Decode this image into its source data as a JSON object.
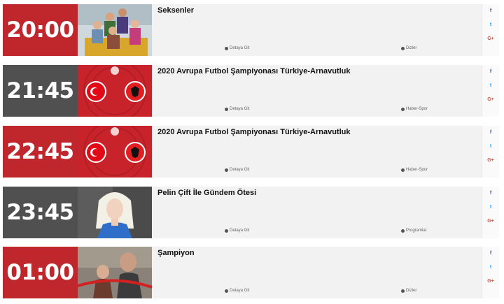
{
  "colors": {
    "red": "#c0272d",
    "dark": "#505050"
  },
  "rows": [
    {
      "time": "20:00",
      "title": "Seksenler",
      "detail_label": "Detaya Git",
      "category": "Dizler",
      "tile": "red",
      "thumb": "family"
    },
    {
      "time": "21:45",
      "title": "2020 Avrupa Futbol Şampiyonası Türkiye-Arnavutluk",
      "detail_label": "Detaya Git",
      "category": "Haber-Spor",
      "tile": "dark",
      "thumb": "flags"
    },
    {
      "time": "22:45",
      "title": "2020 Avrupa Futbol Şampiyonası Türkiye-Arnavutluk",
      "detail_label": "Detaya Git",
      "category": "Haber-Spor",
      "tile": "red",
      "thumb": "flags"
    },
    {
      "time": "23:45",
      "title": "Pelin Çift İle Gündem Ötesi",
      "detail_label": "Detaya Git",
      "category": "Programlar",
      "tile": "dark",
      "thumb": "host"
    },
    {
      "time": "01:00",
      "title": "Şampiyon",
      "detail_label": "Detaya Git",
      "category": "Dizler",
      "tile": "red",
      "thumb": "drama"
    }
  ],
  "social": {
    "facebook": "f",
    "twitter": "t",
    "googleplus": "G+"
  }
}
